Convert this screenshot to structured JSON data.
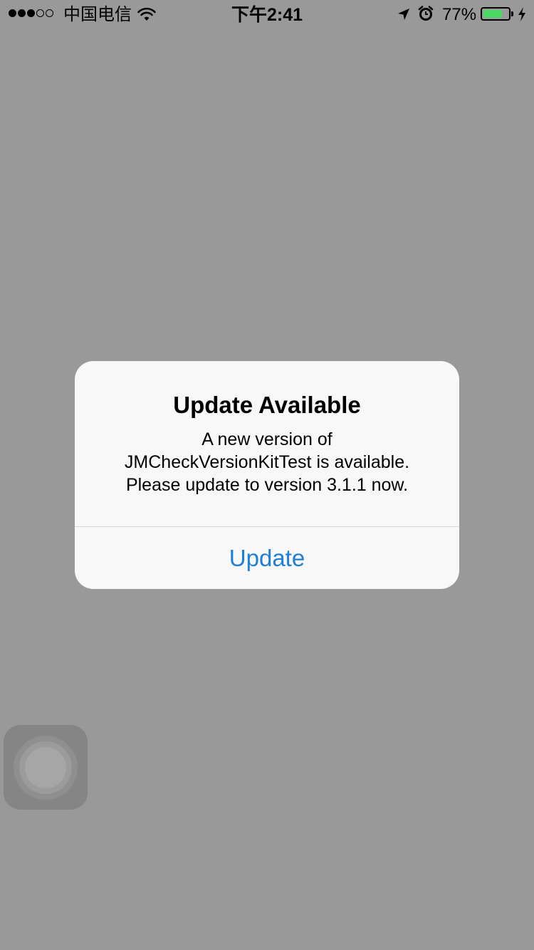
{
  "status_bar": {
    "carrier": "中国电信",
    "time": "下午2:41",
    "battery_percent": "77%",
    "battery_level": 0.77,
    "signal_bars_filled": 3,
    "signal_bars_total": 5,
    "battery_color": "#4cd964"
  },
  "alert": {
    "title": "Update Available",
    "message_lines": [
      "A new version of",
      "JMCheckVersionKitTest is available.",
      "Please update to version 3.1.1 now."
    ],
    "button_label": "Update",
    "button_color": "#1f7fd6"
  },
  "assistive_touch": {
    "icon": "assistive-touch-icon"
  }
}
